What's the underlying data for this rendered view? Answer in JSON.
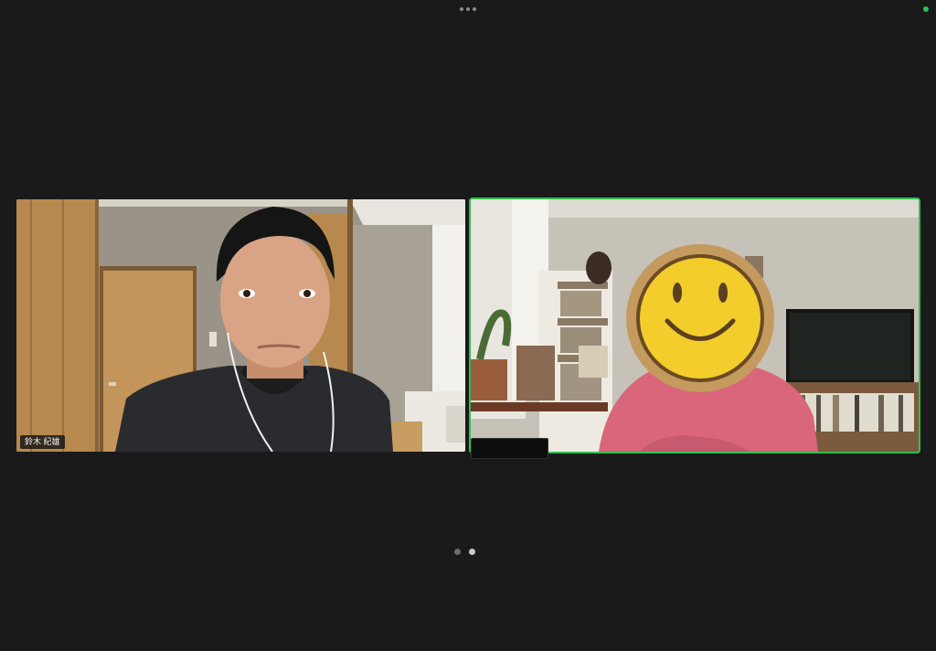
{
  "window": {
    "more_icon": "ellipsis-horizontal-icon",
    "status_color": "#23c552"
  },
  "participants": [
    {
      "name": "鈴木 紀雄",
      "active_speaker": false
    },
    {
      "name": "",
      "active_speaker": true,
      "face_covered_by": "smiley-face-icon"
    }
  ],
  "pagination": {
    "pages": 2,
    "current": 2
  },
  "colors": {
    "background": "#1a1a1a",
    "active_speaker_border": "#2fbf4f",
    "smiley_face": "#f2cd2c"
  }
}
